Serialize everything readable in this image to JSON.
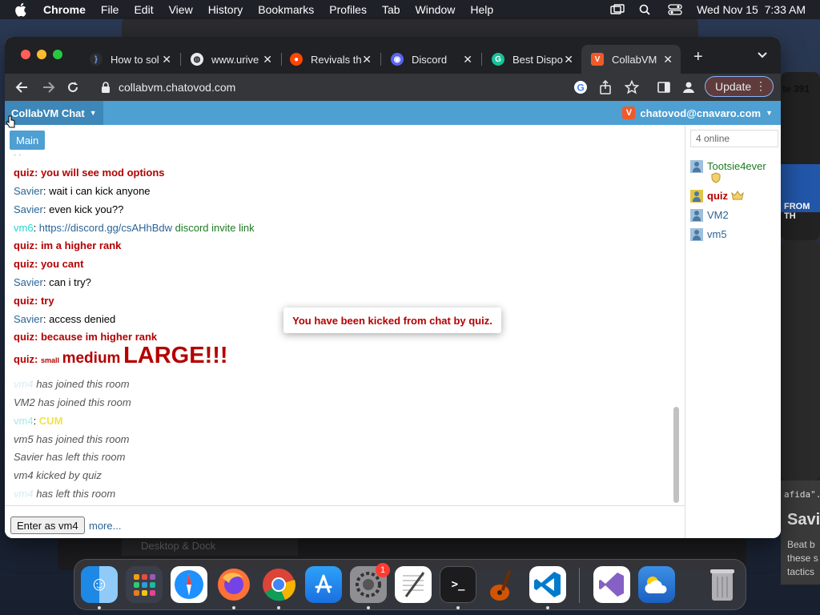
{
  "menubar": {
    "app_name": "Chrome",
    "items": [
      "File",
      "Edit",
      "View",
      "History",
      "Bookmarks",
      "Profiles",
      "Tab",
      "Window",
      "Help"
    ],
    "datetime": "Wed Nov 15  7:33 AM"
  },
  "browser": {
    "tabs": [
      {
        "title": "How to sol",
        "favicon": "code-icon",
        "color": "#3b6fd4"
      },
      {
        "title": "www.urive",
        "favicon": "globe-icon",
        "color": "#5f6368"
      },
      {
        "title": "Revivals th",
        "favicon": "reddit-icon",
        "color": "#ff4500"
      },
      {
        "title": "Discord",
        "favicon": "discord-icon",
        "color": "#5865f2"
      },
      {
        "title": "Best Dispo",
        "favicon": "grammarly-icon",
        "color": "#15c39a"
      },
      {
        "title": "CollabVM",
        "favicon": "collabvm-icon",
        "color": "#f05a28"
      }
    ],
    "url": "collabvm.chatovod.com",
    "update_label": "Update"
  },
  "app": {
    "brand": "CollabVM Chat",
    "user_email": "chatovod@cnavaro.com",
    "room_tab": "Main",
    "online_count": "4 online",
    "enter_button": "Enter as vm4",
    "more_link": "more...",
    "toast": "You have been kicked from chat by quiz."
  },
  "messages": [
    {
      "user": "quiz",
      "text": ": you will see mod options"
    },
    {
      "user": "Savier",
      "text": ": wait i can kick anyone"
    },
    {
      "user": "Savier",
      "text": ": even kick you??"
    },
    {
      "user": "vm6",
      "link": "https://discord.gg/csAHhBdw",
      "text": "discord invite link"
    },
    {
      "user": "quiz",
      "text": ": im a higher rank"
    },
    {
      "user": "quiz",
      "text": ": you cant"
    },
    {
      "user": "Savier",
      "text": ": can i try?"
    },
    {
      "user": "quiz",
      "text": ": try"
    },
    {
      "user": "Savier",
      "text": ": access denied"
    },
    {
      "user": "quiz",
      "text": ": because im higher rank"
    },
    {
      "user": "quiz",
      "small": "small",
      "medium": "medium",
      "large": "LARGE!!!"
    },
    {
      "user": "vm4",
      "text": "has joined this room"
    },
    {
      "text": "VM2 has joined this room"
    },
    {
      "user": "vm4",
      "text": "CUM"
    },
    {
      "text": "vm5 has joined this room"
    },
    {
      "text": "Savier has left this room"
    },
    {
      "text": "vm4 kicked by quiz"
    },
    {
      "user": "vm4",
      "text": "has left this room"
    }
  ],
  "users": [
    {
      "name": "Tootsie4ever"
    },
    {
      "name": "quiz"
    },
    {
      "name": "VM2"
    },
    {
      "name": "vm5"
    }
  ],
  "background": {
    "count_text": "te 391",
    "banner_text": "FROM TH",
    "code_text": "afida\".",
    "heading": "Savi",
    "body_lines": [
      "Beat b",
      "these s",
      "tactics"
    ],
    "dock_window_label": "Desktop & Dock"
  },
  "dock": {
    "items": [
      "Finder",
      "Launchpad",
      "Safari",
      "Firefox",
      "Chrome",
      "App Store",
      "System Settings",
      "TextEdit",
      "Terminal",
      "GarageBand",
      "VS Code",
      "Visual Studio",
      "Weather",
      "Trash"
    ],
    "settings_badge": "1"
  }
}
